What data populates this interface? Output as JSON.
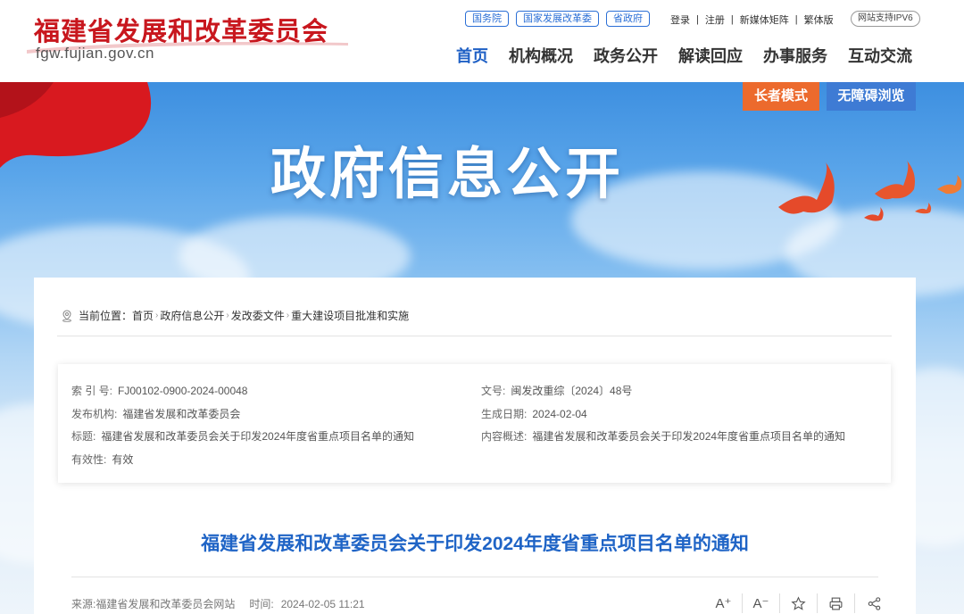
{
  "header": {
    "site_name": "福建省发展和改革委员会",
    "domain": "fgw.fujian.gov.cn",
    "pill_links": [
      "国务院",
      "国家发展改革委",
      "省政府"
    ],
    "util_links": [
      "登录",
      "注册",
      "新媒体矩阵",
      "繁体版"
    ],
    "ipv6_badge": "网站支持IPV6",
    "nav": [
      "首页",
      "机构概况",
      "政务公开",
      "解读回应",
      "办事服务",
      "互动交流"
    ],
    "nav_active": "首页"
  },
  "banner": {
    "title": "政府信息公开",
    "elder_mode": "长者模式",
    "accessible_mode": "无障碍浏览"
  },
  "breadcrumb": {
    "prefix": "当前位置：",
    "items": [
      "首页",
      "政府信息公开",
      "发改委文件",
      "重大建设项目批准和实施"
    ]
  },
  "meta": {
    "index_label": "索 引 号:",
    "index_value": "FJ00102-0900-2024-00048",
    "doc_no_label": "文号:",
    "doc_no_value": "闽发改重综〔2024〕48号",
    "publisher_label": "发布机构:",
    "publisher_value": "福建省发展和改革委员会",
    "date_label": "生成日期:",
    "date_value": "2024-02-04",
    "title_label": "标题:",
    "title_value": "福建省发展和改革委员会关于印发2024年度省重点项目名单的通知",
    "summary_label": "内容概述:",
    "summary_value": "福建省发展和改革委员会关于印发2024年度省重点项目名单的通知",
    "validity_label": "有效性:",
    "validity_value": "有效"
  },
  "article": {
    "title": "福建省发展和改革委员会关于印发2024年度省重点项目名单的通知",
    "source": "来源:福建省发展和改革委员会网站",
    "time_label": "时间:",
    "time_value": "2024-02-05 11:21"
  },
  "tools": {
    "font_increase": "A⁺",
    "font_decrease": "A⁻"
  },
  "colors": {
    "brand_red": "#c8171e",
    "nav_blue": "#1f60c5",
    "title_blue": "#1f64c6",
    "elder_orange": "#ec6a2d",
    "access_blue": "#3e7bd4"
  }
}
